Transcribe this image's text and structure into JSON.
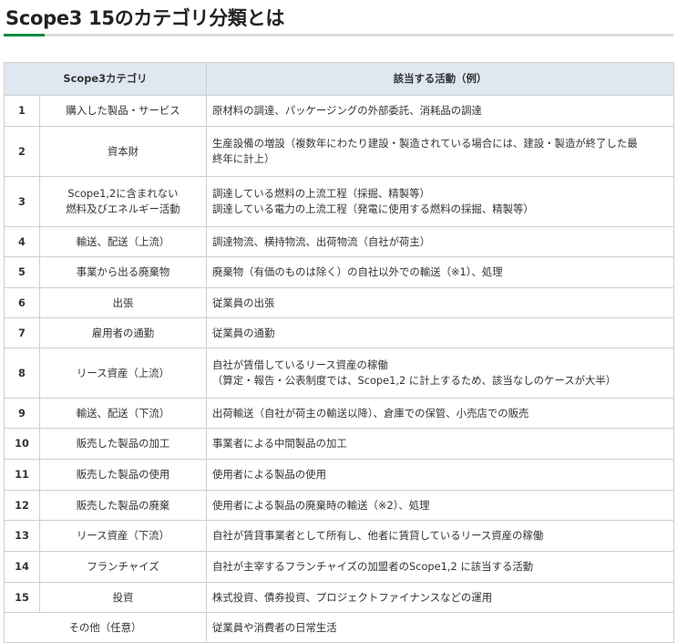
{
  "title": "Scope3 15のカテゴリ分類とは",
  "table": {
    "header_category": "Scope3カテゴリ",
    "header_activity": "該当する活動（例）",
    "rows": [
      {
        "no": "1",
        "category": [
          "購入した製品・サービス"
        ],
        "activity": [
          "原材料の調達、パッケージングの外部委託、消耗品の調達"
        ]
      },
      {
        "no": "2",
        "category": [
          "資本財"
        ],
        "activity": [
          "生産設備の増設（複数年にわたり建設・製造されている場合には、建設・製造が終了した最",
          "終年に計上）"
        ]
      },
      {
        "no": "3",
        "category": [
          "Scope1,2に含まれない",
          "燃料及びエネルギー活動"
        ],
        "activity": [
          "調達している燃料の上流工程（採掘、精製等）",
          "調達している電力の上流工程（発電に使用する燃料の採掘、精製等）"
        ]
      },
      {
        "no": "4",
        "category": [
          "輸送、配送（上流）"
        ],
        "activity": [
          "調達物流、横持物流、出荷物流（自社が荷主）"
        ]
      },
      {
        "no": "5",
        "category": [
          "事業から出る廃棄物"
        ],
        "activity": [
          "廃棄物（有価のものは除く）の自社以外での輸送（※1）、処理"
        ]
      },
      {
        "no": "6",
        "category": [
          "出張"
        ],
        "activity": [
          "従業員の出張"
        ]
      },
      {
        "no": "7",
        "category": [
          "雇用者の通勤"
        ],
        "activity": [
          "従業員の通勤"
        ]
      },
      {
        "no": "8",
        "category": [
          "リース資産（上流）"
        ],
        "activity": [
          "自社が賃借しているリース資産の稼働",
          "（算定・報告・公表制度では、Scope1,2 に計上するため、該当なしのケースが大半）"
        ]
      },
      {
        "no": "9",
        "category": [
          "輸送、配送（下流）"
        ],
        "activity": [
          "出荷輸送（自社が荷主の輸送以降）、倉庫での保管、小売店での販売"
        ]
      },
      {
        "no": "10",
        "category": [
          "販売した製品の加工"
        ],
        "activity": [
          "事業者による中間製品の加工"
        ]
      },
      {
        "no": "11",
        "category": [
          "販売した製品の使用"
        ],
        "activity": [
          "使用者による製品の使用"
        ]
      },
      {
        "no": "12",
        "category": [
          "販売した製品の廃棄"
        ],
        "activity": [
          "使用者による製品の廃棄時の輸送（※2）、処理"
        ]
      },
      {
        "no": "13",
        "category": [
          "リース資産（下流）"
        ],
        "activity": [
          "自社が賃貸事業者として所有し、他者に賃貸しているリース資産の稼働"
        ]
      },
      {
        "no": "14",
        "category": [
          "フランチャイズ"
        ],
        "activity": [
          "自社が主宰するフランチャイズの加盟者のScope1,2 に該当する活動"
        ]
      },
      {
        "no": "15",
        "category": [
          "投資"
        ],
        "activity": [
          "株式投資、債券投資、プロジェクトファイナンスなどの運用"
        ]
      }
    ],
    "other": {
      "category": "その他（任意）",
      "activity": "従業員や消費者の日常生活"
    }
  }
}
